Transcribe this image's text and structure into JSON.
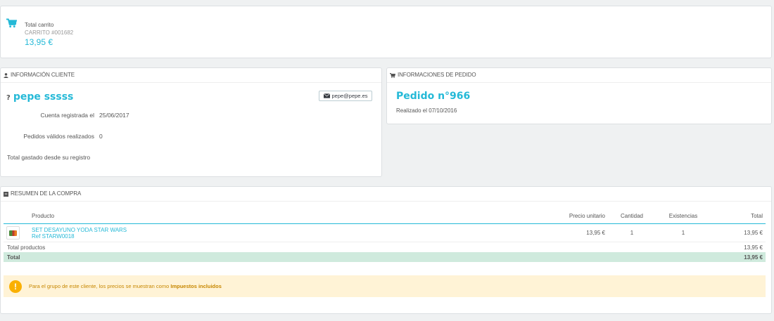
{
  "cart": {
    "label": "Total carrito",
    "id": "CARRITO #001682",
    "total": "13,95 €"
  },
  "customer": {
    "heading": "INFORMACIÓN CLIENTE",
    "prefix": "?",
    "name": "pepe sssss",
    "email": "pepe@pepe.es",
    "registered_label": "Cuenta registrada el",
    "registered_value": "25/06/2017",
    "orders_label": "Pedidos válidos realizados",
    "orders_value": "0",
    "spent_label": "Total gastado desde su registro"
  },
  "order": {
    "heading": "INFORMACIONES DE PEDIDO",
    "title": "Pedido n°966",
    "date": "Realizado el 07/10/2016"
  },
  "summary": {
    "heading": "RESUMEN DE LA COMPRA",
    "columns": {
      "product": "Producto",
      "unit_price": "Precio unitario",
      "quantity": "Cantidad",
      "stock": "Existencias",
      "total": "Total"
    },
    "rows": [
      {
        "name": "SET DESAYUNO YODA STAR WARS",
        "ref": "Ref STARW0018",
        "unit_price": "13,95 €",
        "quantity": "1",
        "stock": "1",
        "total": "13,95 €"
      }
    ],
    "subtotal_label": "Total productos",
    "subtotal_value": "13,95 €",
    "total_label": "Total",
    "total_value": "13,95 €",
    "alert_text": "Para el grupo de este cliente, los precios se muestran como",
    "alert_bold": "Impuestos incluidos"
  },
  "colors": {
    "accent": "#25b9d7",
    "total_row": "#cfeadd",
    "alert_bg": "#fff3d6",
    "alert_icon": "#fab000"
  }
}
